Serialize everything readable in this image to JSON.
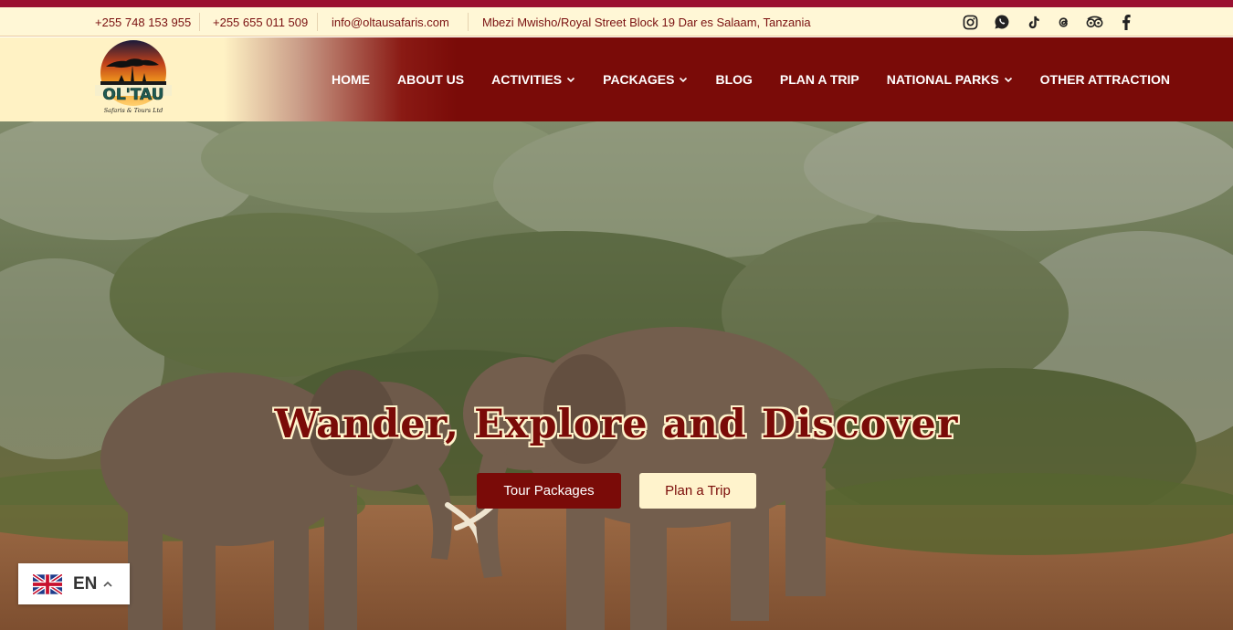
{
  "topbar": {
    "phone1": "+255 748 153 955",
    "phone2": "+255 655 011 509",
    "email": "info@oltausafaris.com",
    "address": "Mbezi Mwisho/Royal Street Block 19 Dar es Salaam, Tanzania",
    "socials": [
      "instagram-icon",
      "whatsapp-icon",
      "tiktok-icon",
      "threads-icon",
      "tripadvisor-icon",
      "facebook-icon"
    ]
  },
  "logo": {
    "name": "OL'TAU",
    "tagline": "Safaris & Tours Ltd"
  },
  "nav": {
    "home": "HOME",
    "about": "ABOUT US",
    "activities": "ACTIVITIES",
    "packages": "PACKAGES",
    "blog": "BLOG",
    "plan": "PLAN A TRIP",
    "parks": "NATIONAL PARKS",
    "other": "OTHER ATTRACTION"
  },
  "hero": {
    "headline": "Wander, Explore and Discover",
    "btn_primary": "Tour Packages",
    "btn_secondary": "Plan a Trip"
  },
  "language": {
    "code": "EN"
  },
  "colors": {
    "brand": "#7a0b08",
    "accent": "#9a1030",
    "cream": "#fff3cc"
  }
}
